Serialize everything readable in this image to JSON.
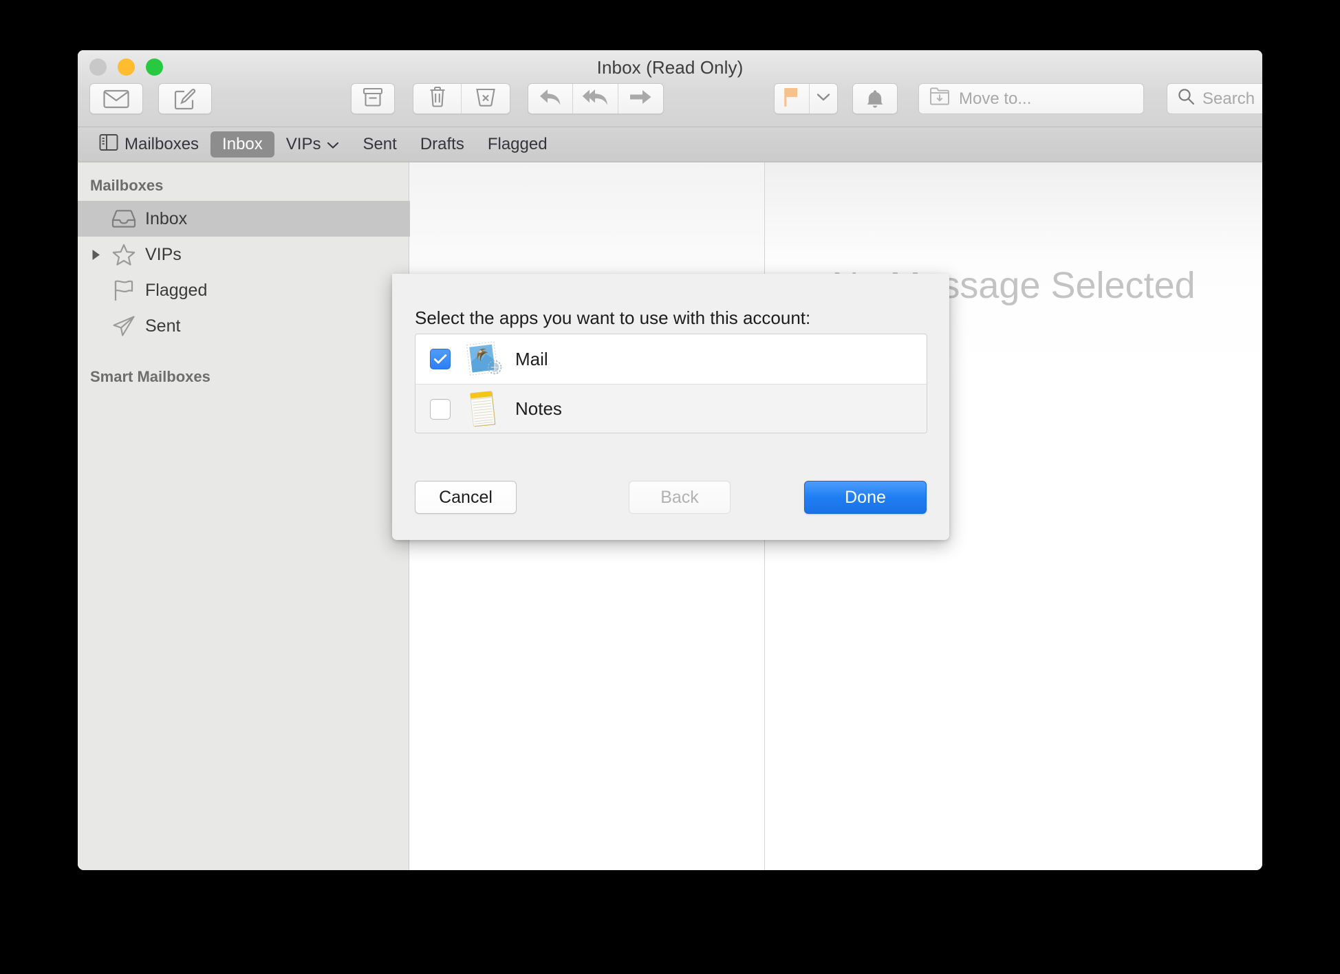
{
  "window": {
    "title": "Inbox (Read Only)",
    "traffic_lights": [
      "close",
      "minimize",
      "zoom"
    ]
  },
  "toolbar": {
    "get_mail_icon": "envelope-icon",
    "compose_icon": "compose-icon",
    "archive_icon": "archive-icon",
    "delete_icon": "trash-icon",
    "junk_icon": "junk-icon",
    "reply_icon": "reply-icon",
    "reply_all_icon": "reply-all-icon",
    "forward_icon": "forward-icon",
    "flag_icon": "flag-icon",
    "flag_chevron_icon": "chevron-down-icon",
    "notify_icon": "bell-icon",
    "move_to_label": "Move to...",
    "move_to_icon": "move-to-icon",
    "search_placeholder": "Search",
    "search_icon": "search-icon"
  },
  "favorites_bar": {
    "mailboxes_icon": "sidebar-toggle-icon",
    "items": [
      {
        "label": "Mailboxes",
        "selected": false
      },
      {
        "label": "Inbox",
        "selected": true
      },
      {
        "label": "VIPs",
        "selected": false,
        "chevron": true
      },
      {
        "label": "Sent",
        "selected": false
      },
      {
        "label": "Drafts",
        "selected": false
      },
      {
        "label": "Flagged",
        "selected": false
      }
    ]
  },
  "sidebar": {
    "section_mailboxes": "Mailboxes",
    "section_smart_mailboxes": "Smart Mailboxes",
    "items": [
      {
        "label": "Inbox",
        "icon": "inbox-icon",
        "selected": true,
        "disclosure": false
      },
      {
        "label": "VIPs",
        "icon": "star-icon",
        "selected": false,
        "disclosure": true
      },
      {
        "label": "Flagged",
        "icon": "flag-icon",
        "selected": false,
        "disclosure": false
      },
      {
        "label": "Sent",
        "icon": "sent-icon",
        "selected": false,
        "disclosure": false
      }
    ]
  },
  "preview": {
    "empty_state": "No Message Selected"
  },
  "sheet": {
    "prompt": "Select the apps you want to use with this account:",
    "apps": [
      {
        "label": "Mail",
        "icon": "mail-app-icon",
        "checked": true
      },
      {
        "label": "Notes",
        "icon": "notes-app-icon",
        "checked": false
      }
    ],
    "buttons": {
      "cancel": "Cancel",
      "back": "Back",
      "done": "Done"
    },
    "back_disabled": true,
    "done_is_default": true
  },
  "colors": {
    "accent_blue": "#2e7ef5",
    "selected_row_gray": "#c6c6c6",
    "favorite_selected_gray": "#8d8d8d",
    "flag_orange": "#f6c18a",
    "notes_yellow": "#f5c518",
    "sidebar_bg": "#e8e8e6",
    "placeholder_gray": "#a8a8a8",
    "empty_state_gray": "#c3c3c3"
  }
}
